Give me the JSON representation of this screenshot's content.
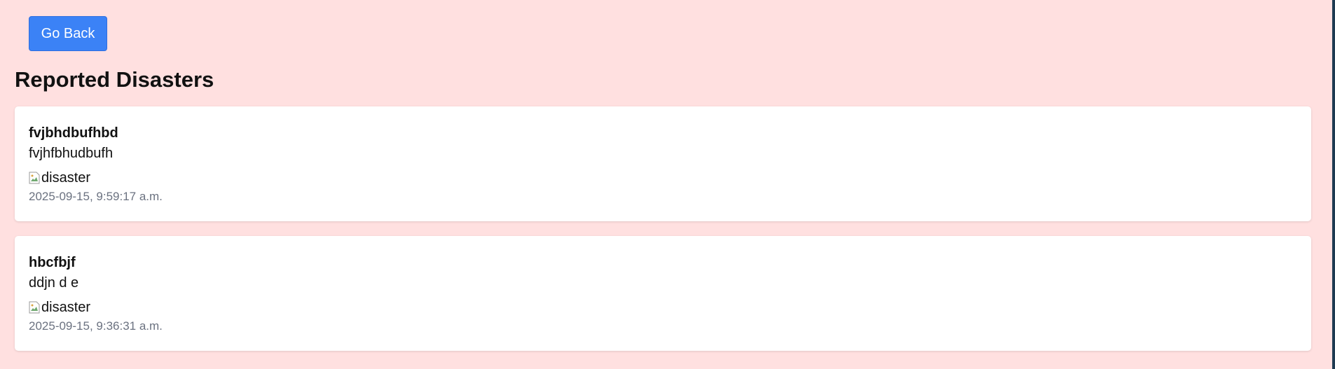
{
  "back_button_label": "Go Back",
  "page_title": "Reported Disasters",
  "disasters": [
    {
      "title": "fvjbhdbufhbd",
      "description": "fvjhfbhudbufh",
      "image_alt": "disaster",
      "timestamp": "2025-09-15, 9:59:17 a.m."
    },
    {
      "title": "hbcfbjf",
      "description": "ddjn d e",
      "image_alt": "disaster",
      "timestamp": "2025-09-15, 9:36:31 a.m."
    }
  ],
  "colors": {
    "background": "#ffe0e0",
    "button": "#3b82f6",
    "card": "#ffffff",
    "timestamp": "#6b7280"
  }
}
